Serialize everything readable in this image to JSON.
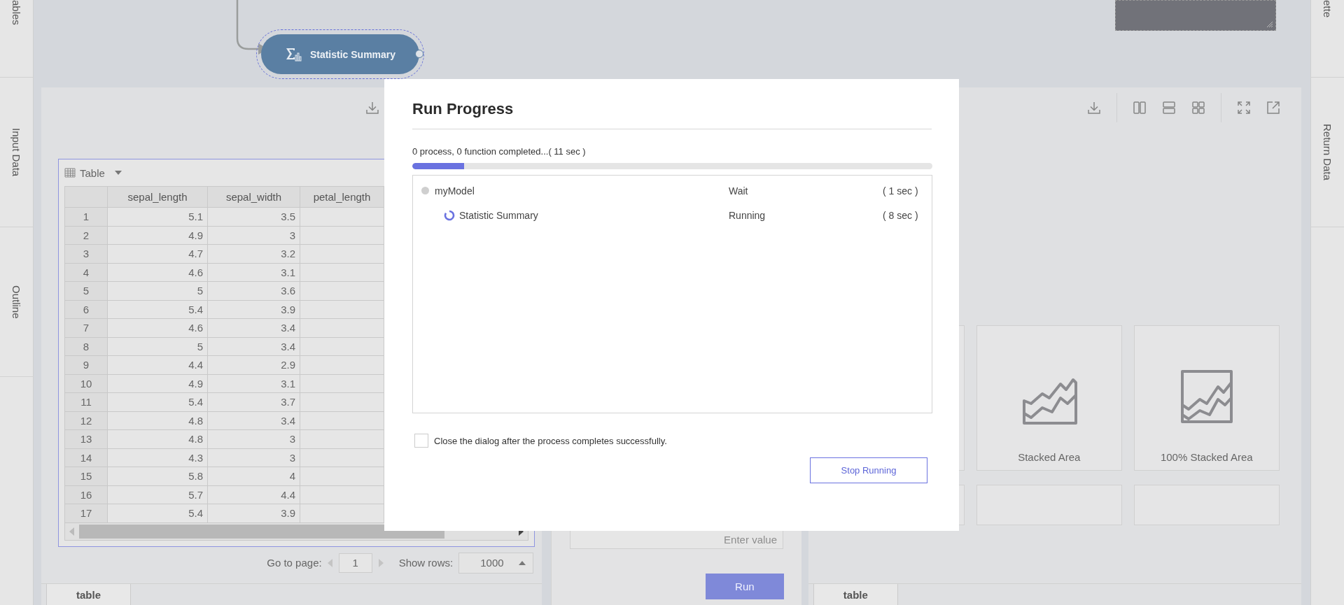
{
  "left_sidebar": {
    "tabs": [
      {
        "label": "ables"
      },
      {
        "label": "Input Data"
      },
      {
        "label": "Outline"
      }
    ]
  },
  "right_sidebar": {
    "tabs": [
      {
        "label": "ette"
      },
      {
        "label": "Return Data"
      }
    ]
  },
  "canvas": {
    "node": {
      "label": "Statistic Summary",
      "selected": true
    }
  },
  "data_panel": {
    "view_label": "Table",
    "columns": [
      "sepal_length",
      "sepal_width",
      "petal_length"
    ],
    "rows": [
      [
        "1",
        "5.1",
        "3.5"
      ],
      [
        "2",
        "4.9",
        "3"
      ],
      [
        "3",
        "4.7",
        "3.2"
      ],
      [
        "4",
        "4.6",
        "3.1"
      ],
      [
        "5",
        "5",
        "3.6"
      ],
      [
        "6",
        "5.4",
        "3.9"
      ],
      [
        "7",
        "4.6",
        "3.4"
      ],
      [
        "8",
        "5",
        "3.4"
      ],
      [
        "9",
        "4.4",
        "2.9"
      ],
      [
        "10",
        "4.9",
        "3.1"
      ],
      [
        "11",
        "5.4",
        "3.7"
      ],
      [
        "12",
        "4.8",
        "3.4"
      ],
      [
        "13",
        "4.8",
        "3"
      ],
      [
        "14",
        "4.3",
        "3"
      ],
      [
        "15",
        "5.8",
        "4"
      ],
      [
        "16",
        "5.7",
        "4.4"
      ],
      [
        "17",
        "5.4",
        "3.9"
      ]
    ],
    "pagination": {
      "go_to_label": "Go to page:",
      "page": "1",
      "rows_label": "Show rows:",
      "rows_value": "1000"
    },
    "bottom_tab": {
      "label": "table",
      "selected": true
    }
  },
  "parameter_panel": {
    "placeholder": "Enter value",
    "run_button": "Run"
  },
  "chart_panel": {
    "chart_types": [
      {
        "label": "Stacked Area",
        "kind": "stacked"
      },
      {
        "label": "100% Stacked Area",
        "kind": "percent"
      }
    ],
    "bottom_tab": {
      "label": "table",
      "selected": true
    }
  },
  "dialog": {
    "title": "Run Progress",
    "status": "0 process, 0 function completed...( 11 sec )",
    "level": 0.1,
    "tasks": [
      {
        "name": "myModel",
        "status": "Wait",
        "time": "( 1 sec )",
        "kind": "idle",
        "children": [
          {
            "name": "Statistic Summary",
            "status": "Running",
            "time": "( 8 sec )",
            "kind": "running"
          }
        ]
      }
    ],
    "close_option": {
      "label": "Close the dialog after the process completes successfully.",
      "checked": false
    },
    "stop_button": "Stop Running"
  }
}
